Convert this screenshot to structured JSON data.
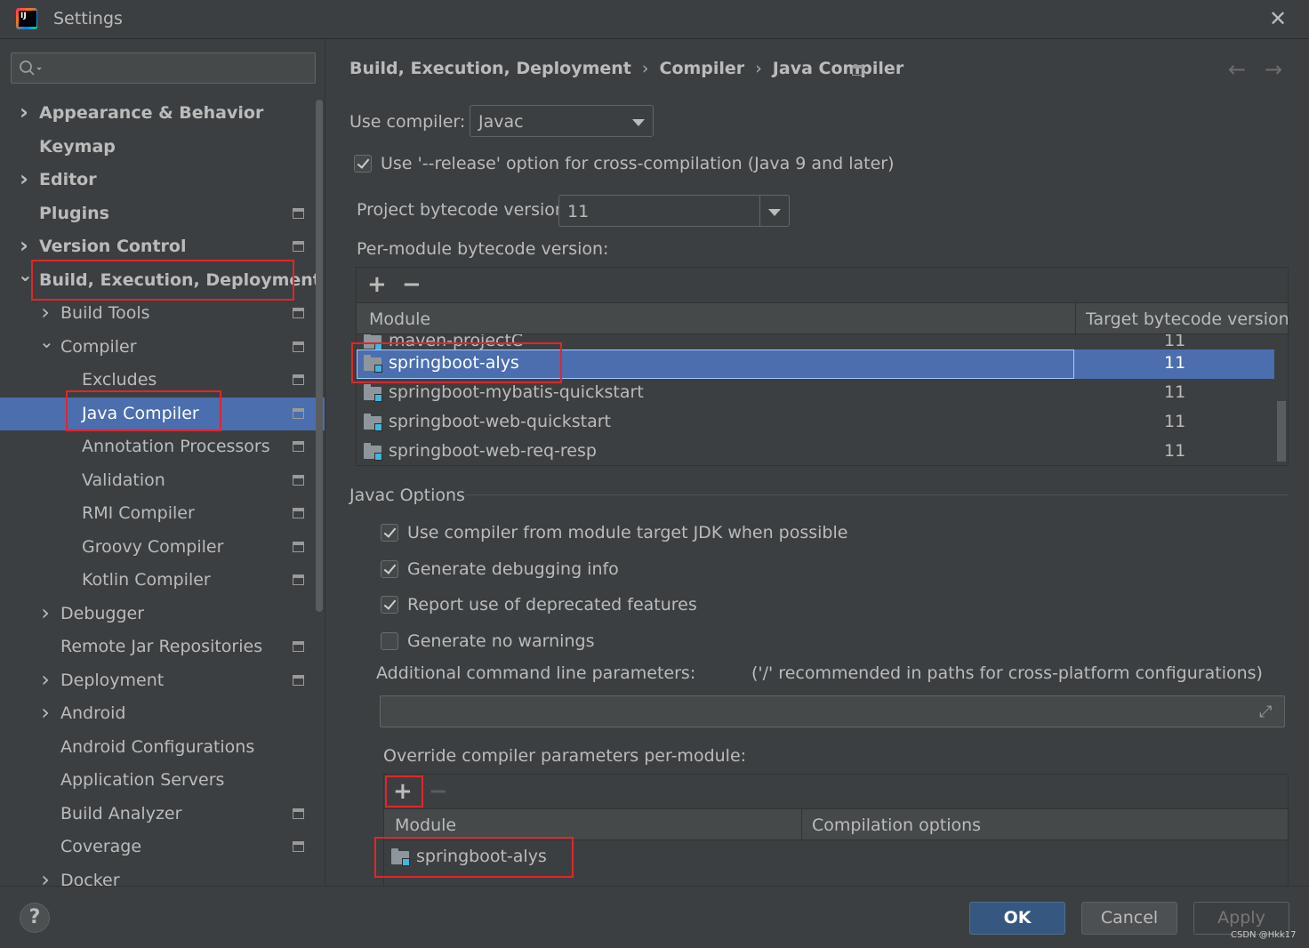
{
  "window": {
    "title": "Settings"
  },
  "sidebar": {
    "search_placeholder": "",
    "items": [
      {
        "label": "Appearance & Behavior",
        "level": 0,
        "expandable": true,
        "expanded": false,
        "bold": true,
        "page_icon": false
      },
      {
        "label": "Keymap",
        "level": 0,
        "expandable": false,
        "bold": true,
        "page_icon": false
      },
      {
        "label": "Editor",
        "level": 0,
        "expandable": true,
        "expanded": false,
        "bold": true,
        "page_icon": false
      },
      {
        "label": "Plugins",
        "level": 0,
        "expandable": false,
        "bold": true,
        "page_icon": true
      },
      {
        "label": "Version Control",
        "level": 0,
        "expandable": true,
        "expanded": false,
        "bold": true,
        "page_icon": true
      },
      {
        "label": "Build, Execution, Deployment",
        "level": 0,
        "expandable": true,
        "expanded": true,
        "bold": true,
        "page_icon": false
      },
      {
        "label": "Build Tools",
        "level": 1,
        "expandable": true,
        "expanded": false,
        "page_icon": true
      },
      {
        "label": "Compiler",
        "level": 1,
        "expandable": true,
        "expanded": true,
        "page_icon": true
      },
      {
        "label": "Excludes",
        "level": 2,
        "expandable": false,
        "page_icon": true
      },
      {
        "label": "Java Compiler",
        "level": 2,
        "expandable": false,
        "page_icon": true,
        "selected": true
      },
      {
        "label": "Annotation Processors",
        "level": 2,
        "expandable": false,
        "page_icon": true
      },
      {
        "label": "Validation",
        "level": 2,
        "expandable": false,
        "page_icon": true
      },
      {
        "label": "RMI Compiler",
        "level": 2,
        "expandable": false,
        "page_icon": true
      },
      {
        "label": "Groovy Compiler",
        "level": 2,
        "expandable": false,
        "page_icon": true
      },
      {
        "label": "Kotlin Compiler",
        "level": 2,
        "expandable": false,
        "page_icon": true
      },
      {
        "label": "Debugger",
        "level": 1,
        "expandable": true,
        "expanded": false,
        "page_icon": false
      },
      {
        "label": "Remote Jar Repositories",
        "level": 1,
        "expandable": false,
        "page_icon": true
      },
      {
        "label": "Deployment",
        "level": 1,
        "expandable": true,
        "expanded": false,
        "page_icon": true
      },
      {
        "label": "Android",
        "level": 1,
        "expandable": true,
        "expanded": false,
        "page_icon": false
      },
      {
        "label": "Android Configurations",
        "level": 1,
        "expandable": false,
        "page_icon": false
      },
      {
        "label": "Application Servers",
        "level": 1,
        "expandable": false,
        "page_icon": false
      },
      {
        "label": "Build Analyzer",
        "level": 1,
        "expandable": false,
        "page_icon": true
      },
      {
        "label": "Coverage",
        "level": 1,
        "expandable": false,
        "page_icon": true
      },
      {
        "label": "Docker",
        "level": 1,
        "expandable": true,
        "expanded": false,
        "page_icon": false
      }
    ]
  },
  "breadcrumb": {
    "parts": [
      "Build, Execution, Deployment",
      "Compiler",
      "Java Compiler"
    ],
    "separator": "›"
  },
  "compiler": {
    "use_compiler_label": "Use compiler:",
    "use_compiler_value": "Javac",
    "release_option_label": "Use '--release' option for cross-compilation (Java 9 and later)",
    "release_option_checked": true,
    "project_bytecode_label": "Project bytecode version:",
    "project_bytecode_value": "11",
    "per_module_label": "Per-module bytecode version:"
  },
  "module_table": {
    "columns": [
      "Module",
      "Target bytecode version"
    ],
    "rows": [
      {
        "module": "maven-projectC",
        "version": "11",
        "partially_hidden": true
      },
      {
        "module": "springboot-alys",
        "version": "11",
        "selected": true
      },
      {
        "module": "springboot-mybatis-quickstart",
        "version": "11"
      },
      {
        "module": "springboot-web-quickstart",
        "version": "11"
      },
      {
        "module": "springboot-web-req-resp",
        "version": "11"
      }
    ]
  },
  "javac_options": {
    "title": "Javac Options",
    "options": [
      {
        "label": "Use compiler from module target JDK when possible",
        "checked": true
      },
      {
        "label": "Generate debugging info",
        "checked": true
      },
      {
        "label": "Report use of deprecated features",
        "checked": true
      },
      {
        "label": "Generate no warnings",
        "checked": false
      }
    ],
    "additional_params_label": "Additional command line parameters:",
    "additional_params_hint": "('/' recommended in paths for cross-platform configurations)",
    "additional_params_value": "",
    "override_label": "Override compiler parameters per-module:"
  },
  "override_table": {
    "columns": [
      "Module",
      "Compilation options"
    ],
    "rows": [
      {
        "module": "springboot-alys",
        "options": ""
      }
    ]
  },
  "footer": {
    "help": "?",
    "ok": "OK",
    "cancel": "Cancel",
    "apply": "Apply",
    "watermark": "CSDN @Hkk17"
  },
  "colors": {
    "background": "#3c3f41",
    "selection": "#4b6eaf",
    "ok_button": "#365880",
    "annotation_box": "#e0262a"
  }
}
